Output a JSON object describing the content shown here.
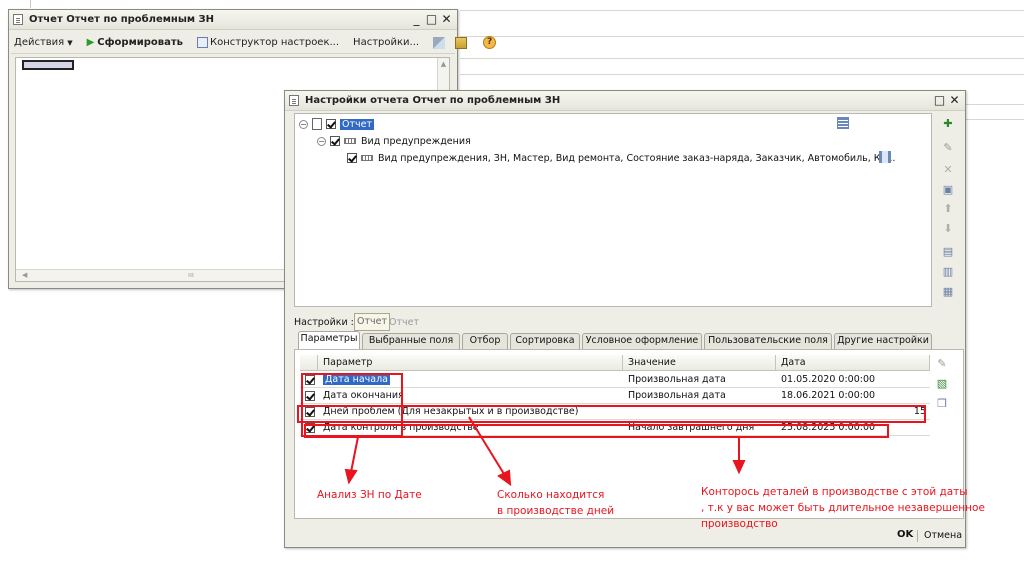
{
  "back_window": {
    "title": "Отчет  Отчет по проблемным ЗН",
    "toolbar": {
      "actions_label": "Действия",
      "generate_label": "Сформировать",
      "constructor_label": "Конструктор настроек...",
      "settings_label": "Настройки..."
    }
  },
  "settings_window": {
    "title": "Настройки отчета  Отчет по проблемным ЗН",
    "tree": {
      "root_label": "Отчет",
      "item1_label": "Вид предупреждения",
      "item2_label": "Вид предупреждения, ЗН, Мастер, Вид ремонта, Состояние заказ-наряда, Заказчик, Автомобиль, Ко..."
    },
    "settings_row": {
      "label": "Настройки :",
      "value1": "Отчет",
      "value2": "Отчет"
    },
    "tabs": [
      "Параметры",
      "Выбранные поля",
      "Отбор",
      "Сортировка",
      "Условное оформление",
      "Пользовательские поля",
      "Другие настройки"
    ],
    "table": {
      "headers": {
        "parameter": "Параметр",
        "value": "Значение",
        "date": "Дата"
      },
      "rows": [
        {
          "parameter": "Дата начала",
          "value": "Произвольная дата",
          "date": "01.05.2020 0:00:00",
          "extra": ""
        },
        {
          "parameter": "Дата окончания",
          "value": "Произвольная дата",
          "date": "18.06.2021 0:00:00",
          "extra": ""
        },
        {
          "parameter": "Дней проблем (Для незакрытых и в производстве)",
          "value": "",
          "date": "",
          "extra": "15"
        },
        {
          "parameter": "Дата контроля в производстве",
          "value": "Начало завтрашнего дня",
          "date": "25.08.2025 0:00:00",
          "extra": ""
        }
      ]
    },
    "footer": {
      "ok_label": "OK",
      "cancel_label": "Отмена"
    }
  },
  "annotations": {
    "date_analysis": "Анализ ЗН по Дате",
    "days_line1": "Сколько находится",
    "days_line2": "в производстве дней",
    "control_line1": "Конторось деталей в производстве с этой даты",
    "control_line2": ", т.к у вас может быть длительное незавершенное",
    "control_line3": "производство"
  },
  "colors": {
    "annotation": "#e8141e",
    "selection": "#316ac5"
  }
}
